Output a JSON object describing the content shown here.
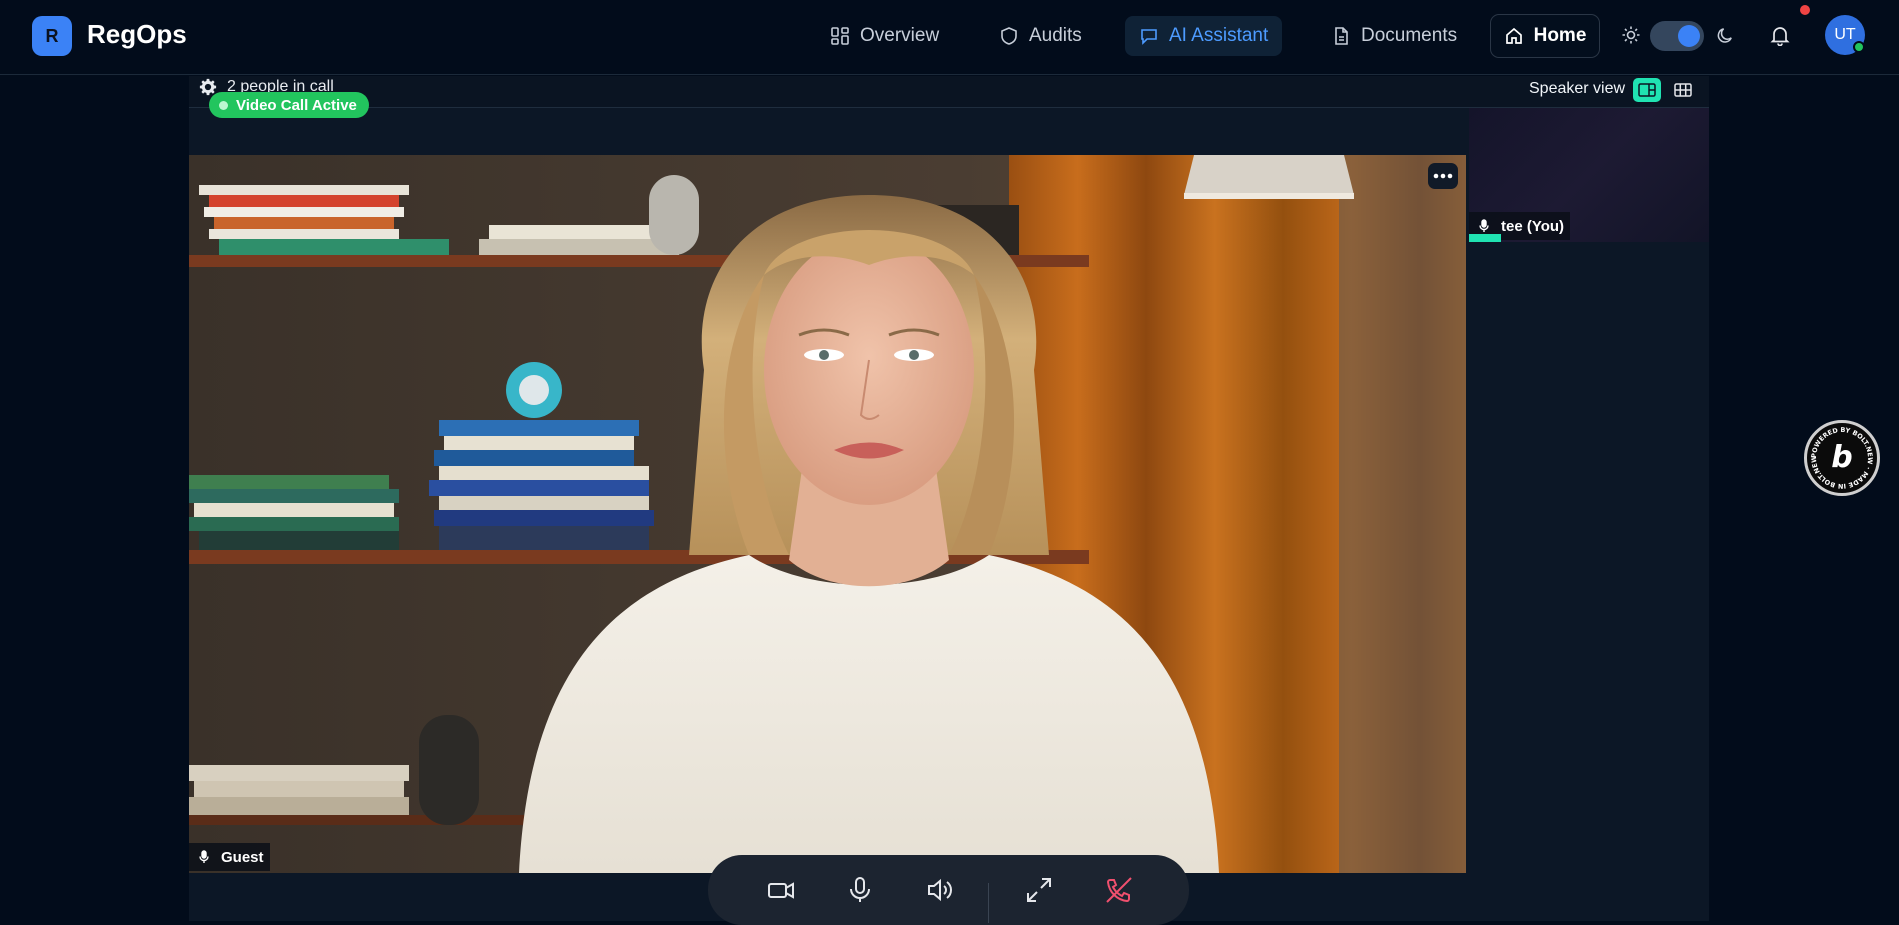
{
  "app": {
    "logo_letter": "R",
    "name": "RegOps"
  },
  "nav": {
    "items": [
      {
        "label": "Overview",
        "icon": "grid-icon"
      },
      {
        "label": "Audits",
        "icon": "shield-icon"
      },
      {
        "label": "AI Assistant",
        "icon": "chat-icon",
        "active": true
      },
      {
        "label": "Documents",
        "icon": "document-icon"
      }
    ],
    "home_label": "Home",
    "user_initials": "UT"
  },
  "call": {
    "people_count": "2 people in call",
    "status_badge": "Video Call Active",
    "view_mode_label": "Speaker view",
    "main_participant": "Guest",
    "self_participant": "tee (You)"
  },
  "colors": {
    "accent": "#3b82f6",
    "active_nav": "#4d9bff",
    "badge_green": "#22c55e",
    "speaking_teal": "#20e3b2",
    "end_call_red": "#f0506e"
  },
  "badge": {
    "text": "POWERED BY BOLT.NEW · MADE IN BOLT.NEW"
  }
}
